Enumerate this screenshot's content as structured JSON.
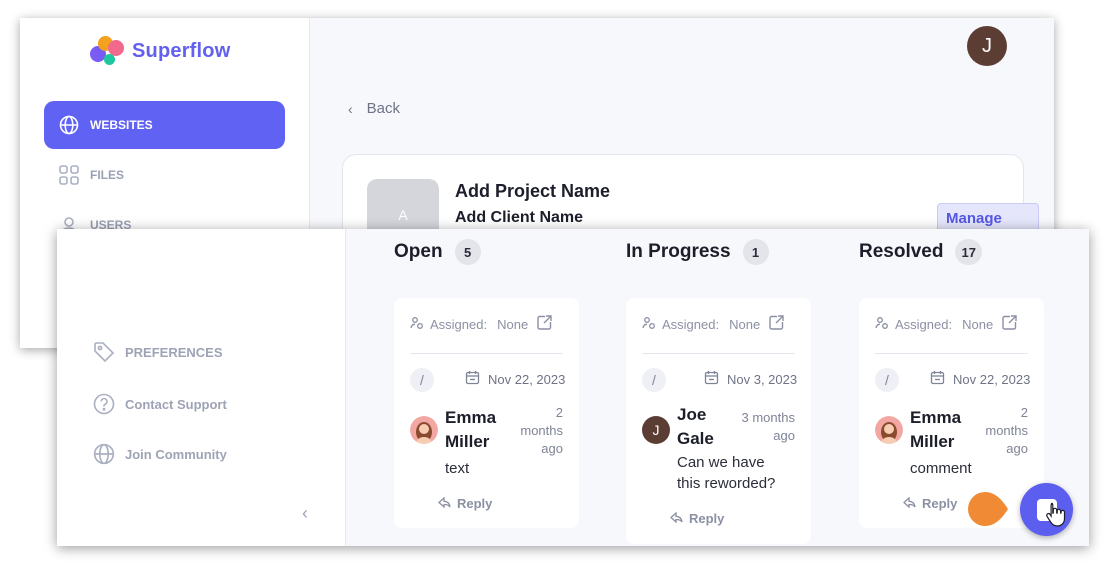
{
  "brand": {
    "name": "Superflow",
    "accent_color": "#6062f4"
  },
  "sidebar": {
    "items": [
      {
        "label": "WEBSITES",
        "icon": "globe-icon",
        "active": true
      },
      {
        "label": "FILES",
        "icon": "grid-icon",
        "active": false
      },
      {
        "label": "USERS",
        "icon": "user-icon",
        "active": false
      }
    ]
  },
  "user": {
    "initial": "J",
    "avatar_color": "#5b3d33"
  },
  "back": {
    "label": "Back"
  },
  "project": {
    "thumb_initial": "A",
    "name": "Add Project Name",
    "client": "Add Client Name",
    "manage_label": "Manage"
  },
  "sidebar2": {
    "items": [
      {
        "label": "PREFERENCES",
        "icon": "tag-icon"
      },
      {
        "label": "Contact Support",
        "icon": "help-circle-icon"
      },
      {
        "label": "Join Community",
        "icon": "globe-icon"
      }
    ]
  },
  "columns": [
    {
      "title": "Open",
      "count": "5",
      "card": {
        "assigned_label": "Assigned:",
        "assigned_value": "None",
        "status": "/",
        "date": "Nov 22, 2023",
        "author_line1": "Emma",
        "author_line2": "Miller",
        "time_line1": "2",
        "time_line2": "months",
        "time_line3": "ago",
        "text_line1": "text",
        "text_line2": "",
        "reply_label": "Reply"
      }
    },
    {
      "title": "In Progress",
      "count": "1",
      "card": {
        "assigned_label": "Assigned:",
        "assigned_value": "None",
        "status": "/",
        "date": "Nov 3, 2023",
        "author_initial": "J",
        "author_line1": "Joe",
        "author_line2": "Gale",
        "time_line1": "3 months",
        "time_line2": "ago",
        "time_line3": "",
        "text_line1": "Can we have",
        "text_line2": "this reworded?",
        "reply_label": "Reply"
      }
    },
    {
      "title": "Resolved",
      "count": "17",
      "card": {
        "assigned_label": "Assigned:",
        "assigned_value": "None",
        "status": "/",
        "date": "Nov 22, 2023",
        "author_line1": "Emma",
        "author_line2": "Miller",
        "time_line1": "2",
        "time_line2": "months",
        "time_line3": "ago",
        "text_line1": "comment",
        "text_line2": "",
        "reply_label": "Reply"
      }
    }
  ],
  "fab": {
    "icon": "comment-icon",
    "color": "#5c5ef0"
  },
  "highlight_color": "#f08a35"
}
